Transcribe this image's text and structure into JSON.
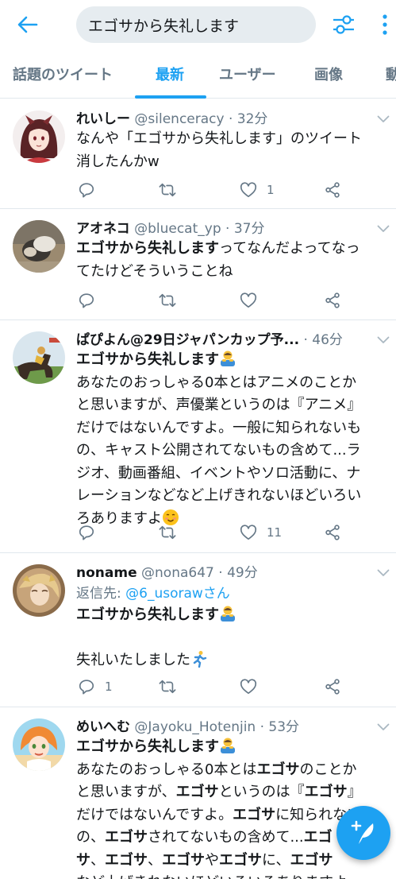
{
  "search": {
    "query": "エゴサから失礼します"
  },
  "tabs": [
    {
      "label": "話題のツイート"
    },
    {
      "label": "最新"
    },
    {
      "label": "ユーザー"
    },
    {
      "label": "画像"
    },
    {
      "label": "動"
    }
  ],
  "colors": {
    "accent": "#1da1f2",
    "muted": "#657786",
    "text": "#14171a"
  },
  "tweets": [
    {
      "name": "れいしー",
      "handle": "@silenceracy",
      "time": "32分",
      "body_lines": [
        "なんや「エゴサから失礼します」のツイート",
        "消したんかw"
      ],
      "likes": "1"
    },
    {
      "name": "アオネコ",
      "handle": "@bluecat_yp",
      "time": "37分",
      "body_bold": "エゴサから失礼します",
      "body_rest": "ってなんだよってなっ",
      "body_line2": "てたけどそういうことね"
    },
    {
      "name": "ぱぴよん@29日ジャパンカップ予...",
      "time": "46分",
      "body_bold": "エゴサから失礼します",
      "body_lines": [
        "あなたのおっしゃる0本とはアニメのことか",
        "と思いますが、声優業というのは『アニメ』",
        "だけではないんですよ。一般に知られないも",
        "の、キャスト公開されてないもの含めて...ラ",
        "ジオ、動画番組、イベントやソロ活動に、ナ",
        "レーションなどなど上げきれないほどいろい",
        "ろありますよ"
      ],
      "likes": "11"
    },
    {
      "name": "noname",
      "handle": "@nona647",
      "time": "49分",
      "reply_prefix": "返信先:",
      "reply_to": "@6_usorawさん",
      "body_bold": "エゴサから失礼します",
      "body_line3": "失礼いたしました",
      "replies": "1"
    },
    {
      "name": "めいへむ",
      "handle": "@Jayoku_Hotenjin",
      "time": "53分",
      "body_bold": "エゴサから失礼します",
      "l1a": "あなたのおっしゃる0本とは",
      "l1b": "エゴサ",
      "l1c": "のことか",
      "l2a": "と思いますが、",
      "l2b": "エゴサ",
      "l2c": "というのは『",
      "l2d": "エゴサ",
      "l2e": "』",
      "l3a": "だけではないんですよ。",
      "l3b": "エゴサ",
      "l3c": "に知られないも",
      "l4a": "の、",
      "l4b": "エゴサ",
      "l4c": "されてないもの含めて...",
      "l4d": "エゴ",
      "l5a": "サ",
      "l5b": "、",
      "l5c": "エゴサ",
      "l5d": "、",
      "l5e": "エゴサ",
      "l5f": "や",
      "l5g": "エゴサ",
      "l5h": "に、",
      "l5i": "エゴサ",
      "l6": "など上げきれないほどいろいろありますよ"
    }
  ]
}
